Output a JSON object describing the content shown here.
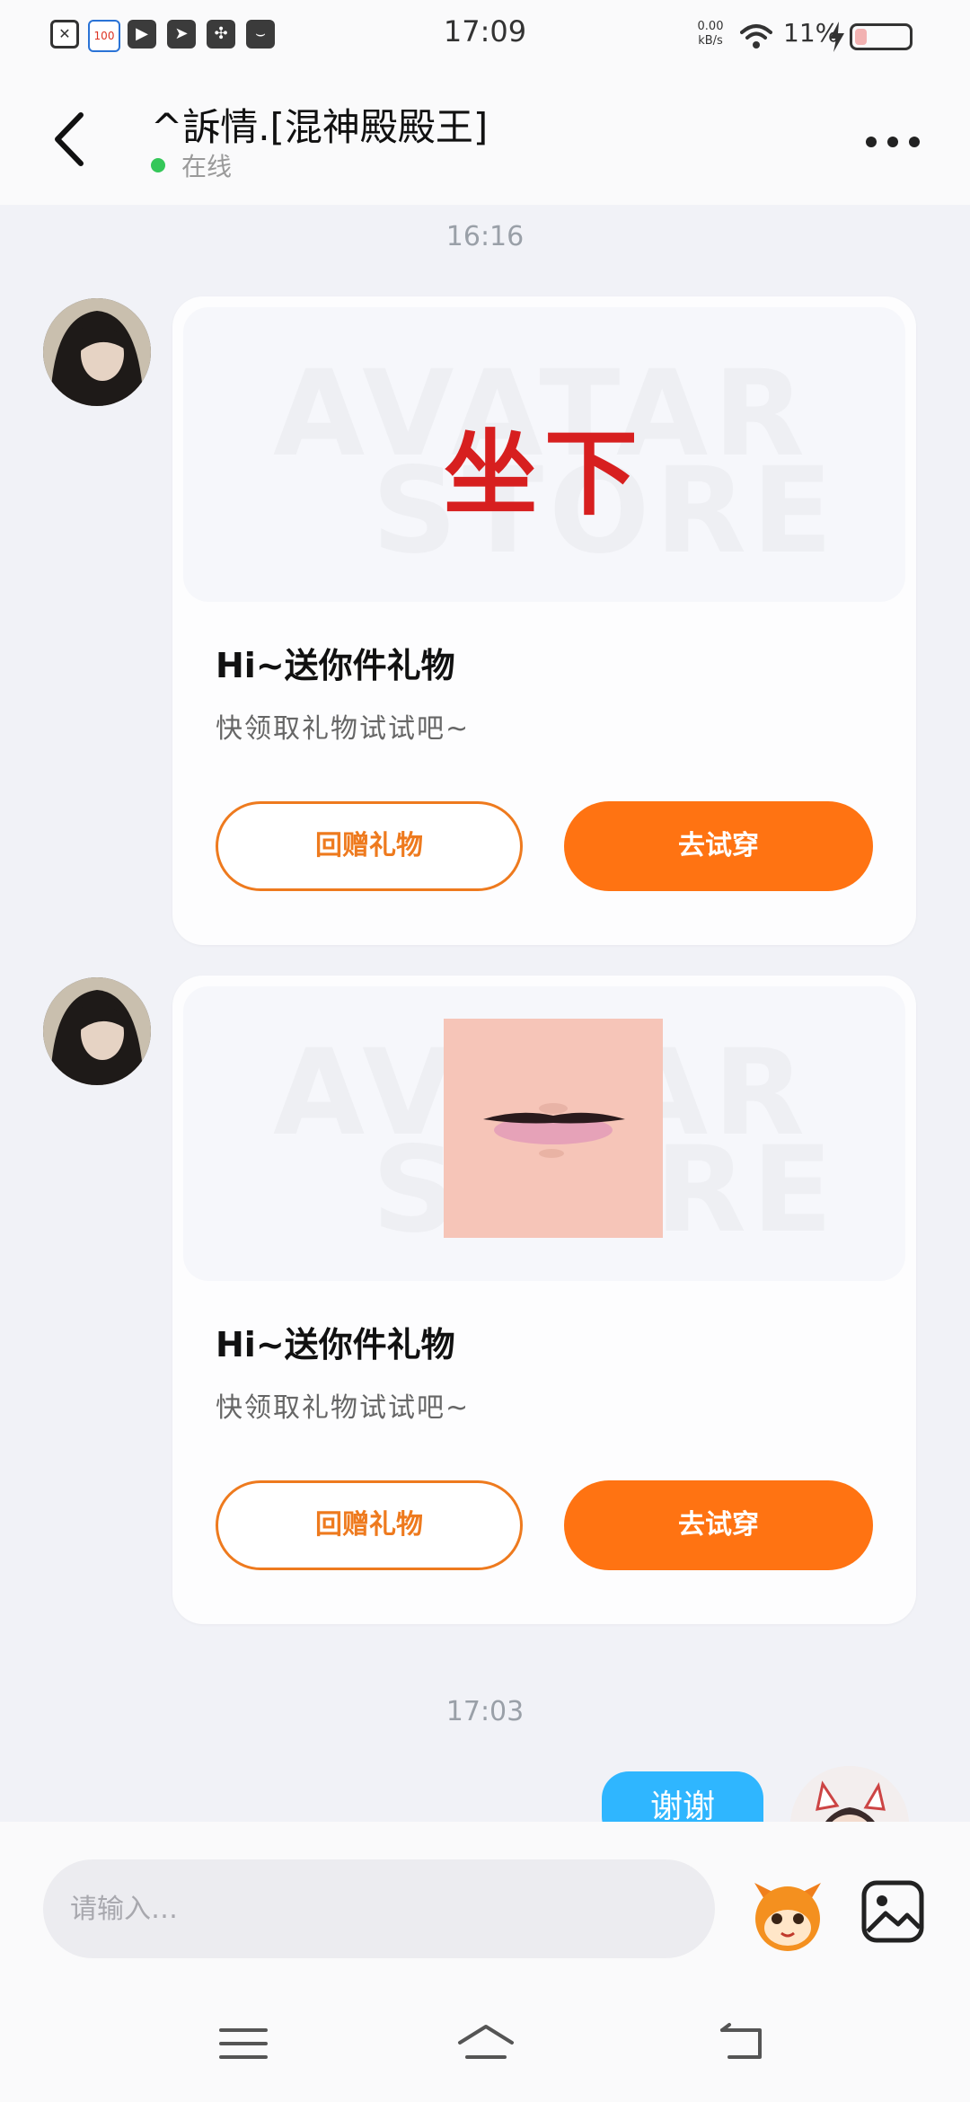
{
  "status_bar": {
    "time": "17:09",
    "net_speed_value": "0.00",
    "net_speed_unit": "kB/s",
    "battery_percent": "11%",
    "battery_level": 0.11,
    "notification_icons": [
      "sim-card-icon",
      "calendar-100-icon",
      "play-icon",
      "send-icon",
      "pinwheel-icon",
      "inbox-icon"
    ]
  },
  "header": {
    "title": "^訴情.[混神殿殿王]",
    "status_text": "在线"
  },
  "chat": {
    "timestamps": [
      "16:16",
      "17:03"
    ],
    "messages": [
      {
        "sticker_text": "坐下",
        "watermark_top": "AVATAR",
        "watermark_bottom": "STORE",
        "title": "Hi~送你件礼物",
        "subtitle": "快领取礼物试试吧~",
        "button_secondary": "回赠礼物",
        "button_primary": "去试穿"
      },
      {
        "image": "lips-sticker",
        "watermark_top": "AVATAR",
        "watermark_bottom": "STORE",
        "title": "Hi~送你件礼物",
        "subtitle": "快领取礼物试试吧~",
        "button_secondary": "回赠礼物",
        "button_primary": "去试穿"
      }
    ],
    "sent": {
      "text": "谢谢"
    }
  },
  "input": {
    "placeholder": "请输入…"
  },
  "nav_icons": [
    "menu-icon",
    "home-icon",
    "back-arrow-icon"
  ],
  "colors": {
    "accent_orange": "#ff7312",
    "outline_orange": "#ee7a1e",
    "sent_bubble": "#2fb6ff",
    "online_green": "#35c759"
  }
}
